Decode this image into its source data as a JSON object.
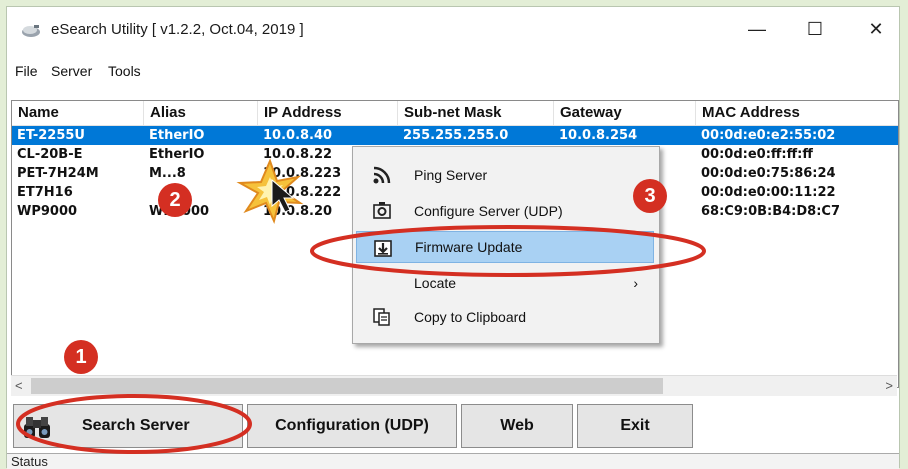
{
  "window": {
    "title": "eSearch Utility [ v1.2.2, Oct.04, 2019 ]",
    "controls": {
      "minimize": "—",
      "maximize": "☐",
      "close": "✕"
    }
  },
  "menubar": [
    "File",
    "Server",
    "Tools"
  ],
  "table": {
    "columns": [
      "Name",
      "Alias",
      "IP Address",
      "Sub-net Mask",
      "Gateway",
      "MAC Address"
    ],
    "rows": [
      [
        "ET-2255U",
        "EtherIO",
        "10.0.8.40",
        "255.255.255.0",
        "10.0.8.254",
        "00:0d:e0:e2:55:02"
      ],
      [
        "CL-20B-E",
        "EtherIO",
        "10.0.8.22",
        "",
        "",
        "00:0d:e0:ff:ff:ff"
      ],
      [
        "PET-7H24M",
        "M...8",
        "10.0.8.223",
        "",
        "",
        "00:0d:e0:75:86:24"
      ],
      [
        "ET7H16",
        "",
        "10.0.8.222",
        "",
        "",
        "00:0d:e0:00:11:22"
      ],
      [
        "WP9000",
        "WP9000",
        "10.0.8.20",
        "",
        "",
        "68:C9:0B:B4:D8:C7"
      ]
    ],
    "selected_row": 0
  },
  "context_menu": {
    "items": [
      {
        "label": "Ping Server",
        "icon": "signal-icon"
      },
      {
        "label": "Configure Server (UDP)",
        "icon": "config-gear-icon"
      },
      {
        "label": "Firmware Update",
        "icon": "download-icon",
        "highlighted": true
      },
      {
        "label": "Locate",
        "submenu_arrow": "›"
      },
      {
        "label": "Copy to Clipboard",
        "icon": "clipboard-icon"
      }
    ]
  },
  "buttons": {
    "search": "Search Server",
    "config": "Configuration (UDP)",
    "web": "Web",
    "exit": "Exit"
  },
  "status": "Status",
  "annotations": {
    "step1": "1",
    "step2": "2",
    "step3": "3"
  },
  "colors": {
    "selection": "#0078d7",
    "highlight": "#a9d1f3",
    "annotation": "#d42f22",
    "background": "#e3eed6"
  }
}
